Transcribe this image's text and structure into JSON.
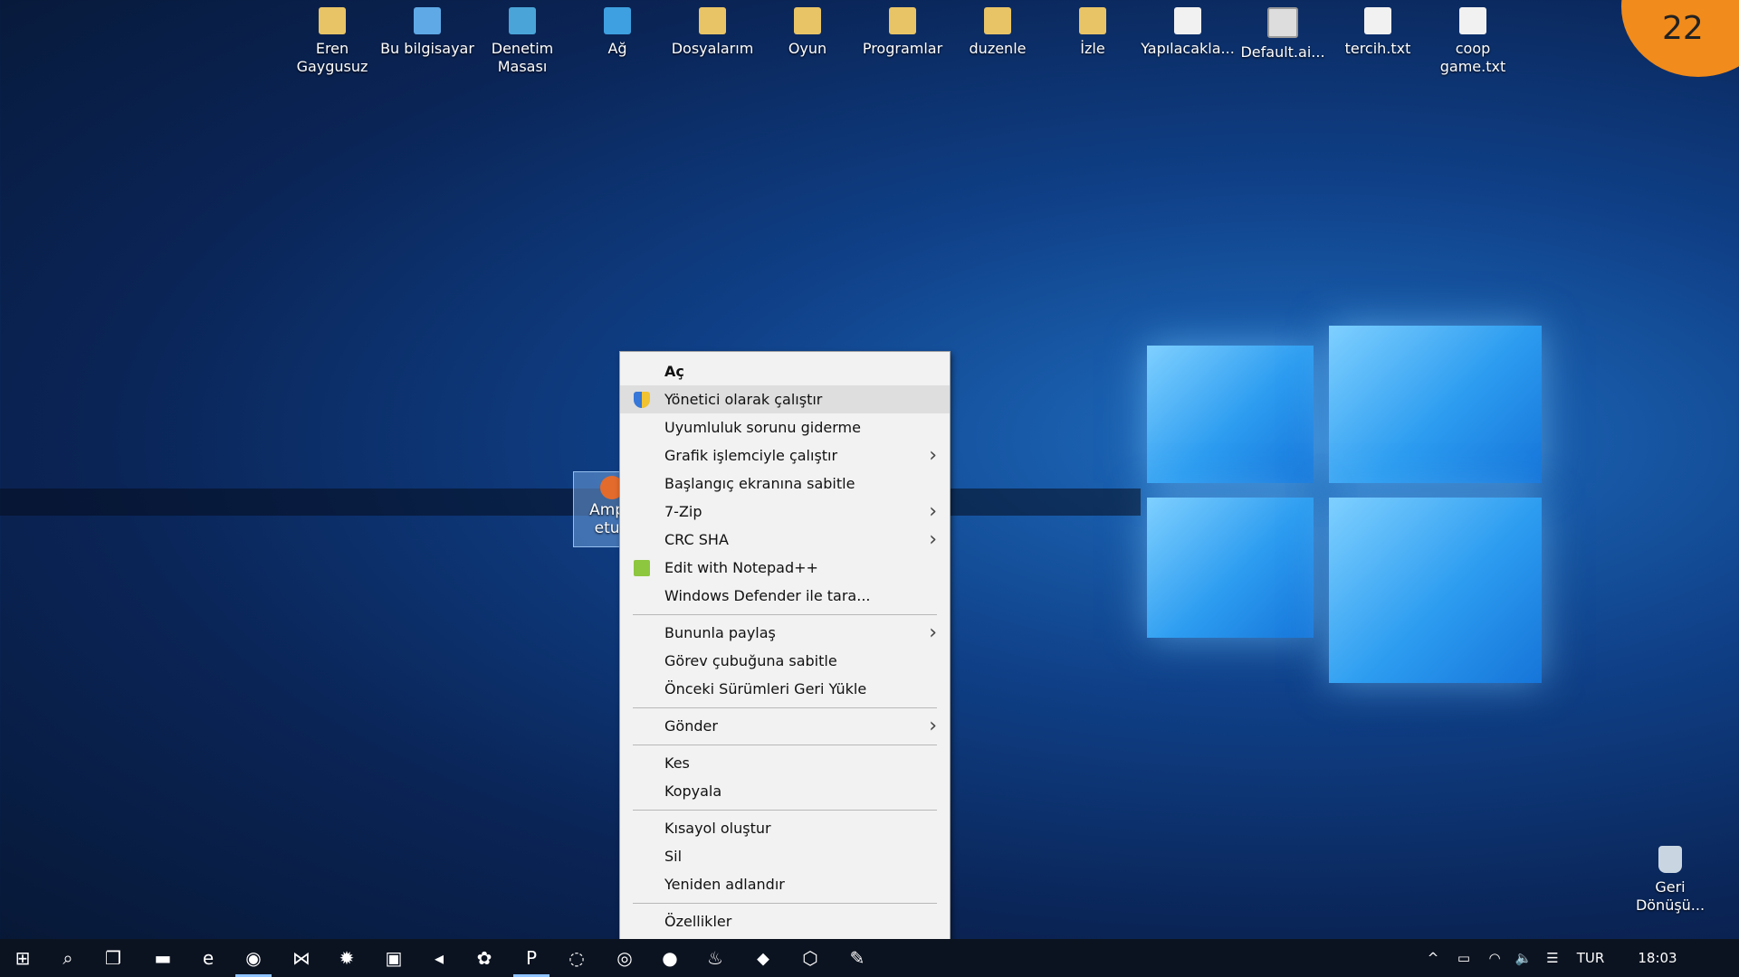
{
  "desktop_icons": [
    {
      "label": "Eren Gaygusuz",
      "icon": "user-folder-icon"
    },
    {
      "label": "Bu bilgisayar",
      "icon": "computer-icon"
    },
    {
      "label": "Denetim Masası",
      "icon": "control-panel-icon"
    },
    {
      "label": "Ağ",
      "icon": "network-icon"
    },
    {
      "label": "Dosyalarım",
      "icon": "folder-icon"
    },
    {
      "label": "Oyun",
      "icon": "folder-icon"
    },
    {
      "label": "Programlar",
      "icon": "folder-icon"
    },
    {
      "label": "duzenle",
      "icon": "folder-icon"
    },
    {
      "label": "İzle",
      "icon": "folder-icon"
    },
    {
      "label": "Yapılacakla...",
      "icon": "text-file-icon"
    },
    {
      "label": "Default.ai...",
      "icon": "document-icon"
    },
    {
      "label": "tercih.txt",
      "icon": "text-file-icon"
    },
    {
      "label": "coop game.txt",
      "icon": "text-file-icon"
    }
  ],
  "selected_icon": {
    "line1": "Ampp",
    "line2": "etup"
  },
  "recycle_bin": {
    "label": "Geri Dönüşü..."
  },
  "badge": "22",
  "context_menu": {
    "items": [
      {
        "label": "Aç",
        "bold": true
      },
      {
        "label": "Yönetici olarak çalıştır",
        "icon": "uac-shield-icon",
        "highlight": true
      },
      {
        "label": "Uyumluluk sorunu giderme"
      },
      {
        "label": "Grafik işlemciyle çalıştır",
        "submenu": true
      },
      {
        "label": "Başlangıç ekranına sabitle"
      },
      {
        "label": "7-Zip",
        "submenu": true
      },
      {
        "label": "CRC SHA",
        "submenu": true
      },
      {
        "label": "Edit with Notepad++",
        "icon": "notepadpp-icon"
      },
      {
        "label": "Windows Defender ile tara..."
      },
      {
        "separator": true
      },
      {
        "label": "Bununla paylaş",
        "submenu": true
      },
      {
        "label": "Görev çubuğuna sabitle"
      },
      {
        "label": "Önceki Sürümleri Geri Yükle"
      },
      {
        "separator": true
      },
      {
        "label": "Gönder",
        "submenu": true
      },
      {
        "separator": true
      },
      {
        "label": "Kes"
      },
      {
        "label": "Kopyala"
      },
      {
        "separator": true
      },
      {
        "label": "Kısayol oluştur"
      },
      {
        "label": "Sil"
      },
      {
        "label": "Yeniden adlandır"
      },
      {
        "separator": true
      },
      {
        "label": "Özellikler"
      }
    ]
  },
  "taskbar": {
    "apps": [
      {
        "name": "start-icon",
        "glyph": "⊞"
      },
      {
        "name": "search-icon",
        "glyph": "⌕"
      },
      {
        "name": "task-view-icon",
        "glyph": "❐"
      },
      {
        "name": "file-explorer-icon",
        "glyph": "▬"
      },
      {
        "name": "edge-icon",
        "glyph": "e"
      },
      {
        "name": "chrome-icon",
        "glyph": "◉",
        "active": true
      },
      {
        "name": "visual-studio-icon",
        "glyph": "⋈"
      },
      {
        "name": "sqlite-icon",
        "glyph": "✹"
      },
      {
        "name": "unity-hub-icon",
        "glyph": "▣"
      },
      {
        "name": "media-icon",
        "glyph": "◂"
      },
      {
        "name": "paint-icon",
        "glyph": "✿"
      },
      {
        "name": "powerpoint-icon",
        "glyph": "P",
        "active": true
      },
      {
        "name": "unity-icon",
        "glyph": "◌"
      },
      {
        "name": "capture-icon",
        "glyph": "◎"
      },
      {
        "name": "origin-icon",
        "glyph": "●"
      },
      {
        "name": "steam-icon",
        "glyph": "♨"
      },
      {
        "name": "uplay-icon",
        "glyph": "⬥"
      },
      {
        "name": "package-icon",
        "glyph": "⬡"
      },
      {
        "name": "paint3d-icon",
        "glyph": "✎"
      }
    ],
    "tray": {
      "chevron": "^",
      "battery": "▭",
      "wifi": "◠",
      "volume": "🔈",
      "ime": "☰",
      "language": "TUR",
      "time": "18:03"
    }
  }
}
